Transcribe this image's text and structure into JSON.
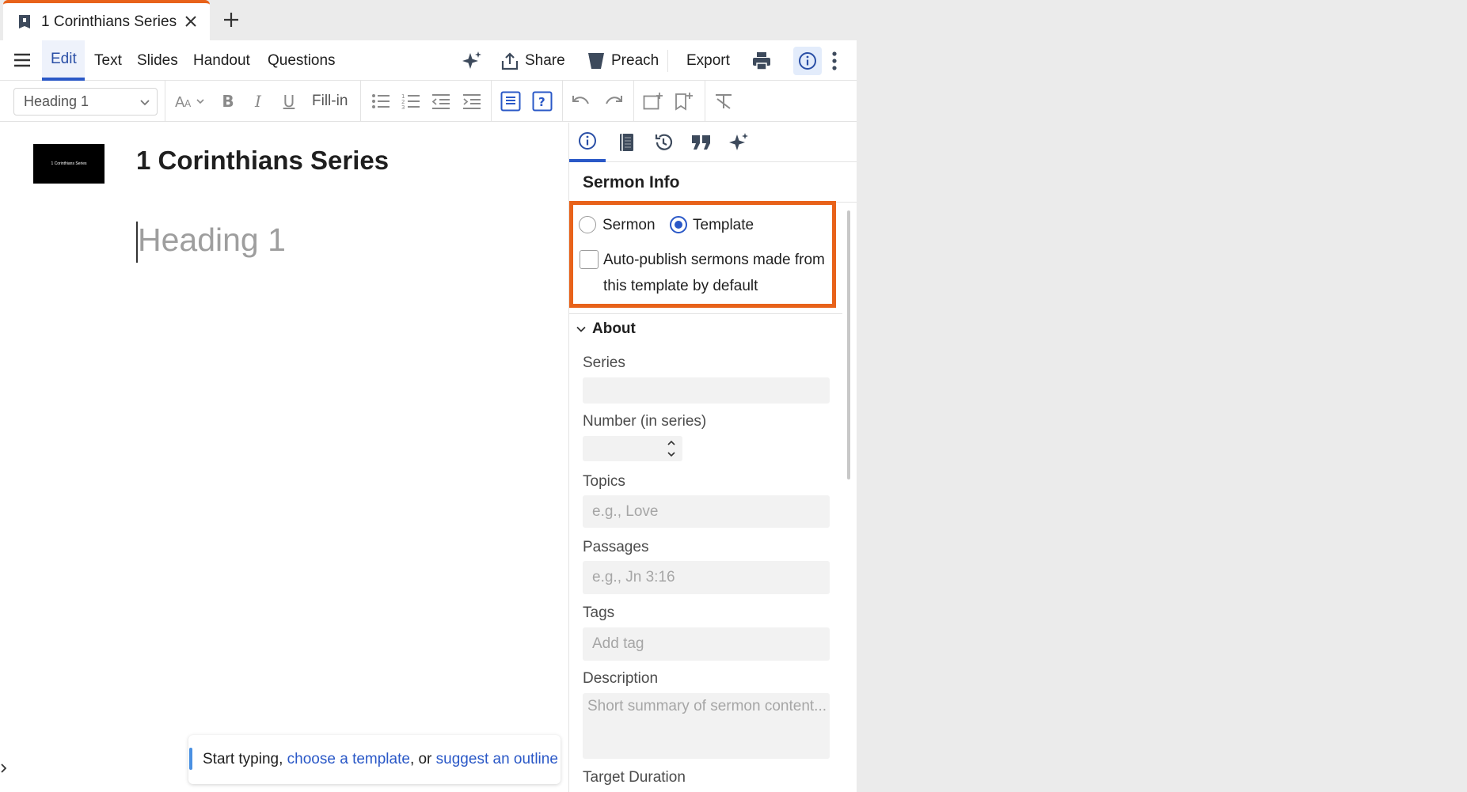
{
  "tab": {
    "title": "1 Corinthians Series"
  },
  "menu": {
    "edit": "Edit",
    "text": "Text",
    "slides": "Slides",
    "handout": "Handout",
    "questions": "Questions",
    "share": "Share",
    "preach": "Preach",
    "export": "Export"
  },
  "toolbar": {
    "style_value": "Heading 1",
    "fill_in": "Fill-in"
  },
  "editor": {
    "thumbnail_text": "1 Corinthians Series",
    "title": "1 Corinthians Series",
    "heading_placeholder": "Heading 1",
    "hint": {
      "prefix": "Start typing, ",
      "link1": "choose a template",
      "middle": ", or ",
      "link2": "suggest an outline"
    }
  },
  "panel": {
    "heading": "Sermon Info",
    "type_options": {
      "sermon": "Sermon",
      "template": "Template",
      "selected": "Template"
    },
    "auto_publish": {
      "label": "Auto-publish sermons made from this template by default",
      "checked": false
    },
    "about": {
      "title": "About",
      "fields": {
        "series": {
          "label": "Series",
          "value": ""
        },
        "number": {
          "label": "Number (in series)",
          "value": ""
        },
        "topics": {
          "label": "Topics",
          "placeholder": "e.g., Love"
        },
        "passages": {
          "label": "Passages",
          "placeholder": "e.g., Jn 3:16"
        },
        "tags": {
          "label": "Tags",
          "placeholder": "Add tag"
        },
        "description": {
          "label": "Description",
          "placeholder": "Short summary of sermon content..."
        },
        "target_duration": {
          "label": "Target Duration"
        }
      }
    }
  },
  "colors": {
    "accent_orange": "#e8621a",
    "accent_blue": "#2a58c7"
  }
}
